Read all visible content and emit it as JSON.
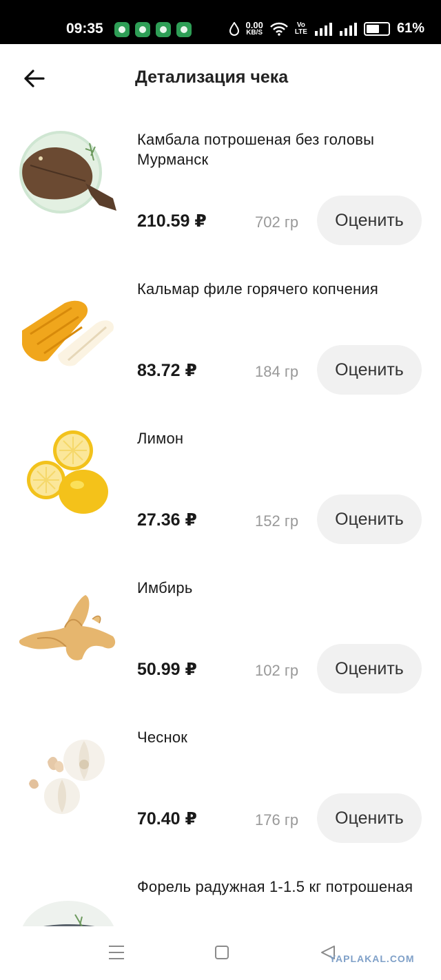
{
  "status_bar": {
    "time": "09:35",
    "net_speed_value": "0.00",
    "net_speed_unit": "KB/S",
    "volte_top": "Vo",
    "volte_bottom": "LTE",
    "battery_percent": "61%",
    "battery_level": 0.61,
    "app_icons": [
      "spotify-icon",
      "vpn-shield-icon",
      "battery-saver-icon",
      "phone-icon"
    ]
  },
  "header": {
    "title": "Детализация чека"
  },
  "items": [
    {
      "name": "Камбала потрошеная без головы Мурманск",
      "price": "210.59 ₽",
      "weight": "702 гр",
      "rate_label": "Оценить",
      "image": "flounder"
    },
    {
      "name": "Кальмар филе горячего копчения",
      "price": "83.72 ₽",
      "weight": "184 гр",
      "rate_label": "Оценить",
      "image": "squid"
    },
    {
      "name": "Лимон",
      "price": "27.36 ₽",
      "weight": "152 гр",
      "rate_label": "Оценить",
      "image": "lemon"
    },
    {
      "name": "Имбирь",
      "price": "50.99 ₽",
      "weight": "102 гр",
      "rate_label": "Оценить",
      "image": "ginger"
    },
    {
      "name": "Чеснок",
      "price": "70.40 ₽",
      "weight": "176 гр",
      "rate_label": "Оценить",
      "image": "garlic"
    },
    {
      "name": "Форель радужная 1-1.5 кг потрошеная",
      "price": "",
      "weight": "",
      "rate_label": "",
      "image": "trout"
    }
  ],
  "watermark": "YAPLAKAL.COM",
  "colors": {
    "status_bg": "#000000",
    "text": "#1a1a1a",
    "muted": "#999999",
    "button_bg": "#f1f1f1"
  }
}
